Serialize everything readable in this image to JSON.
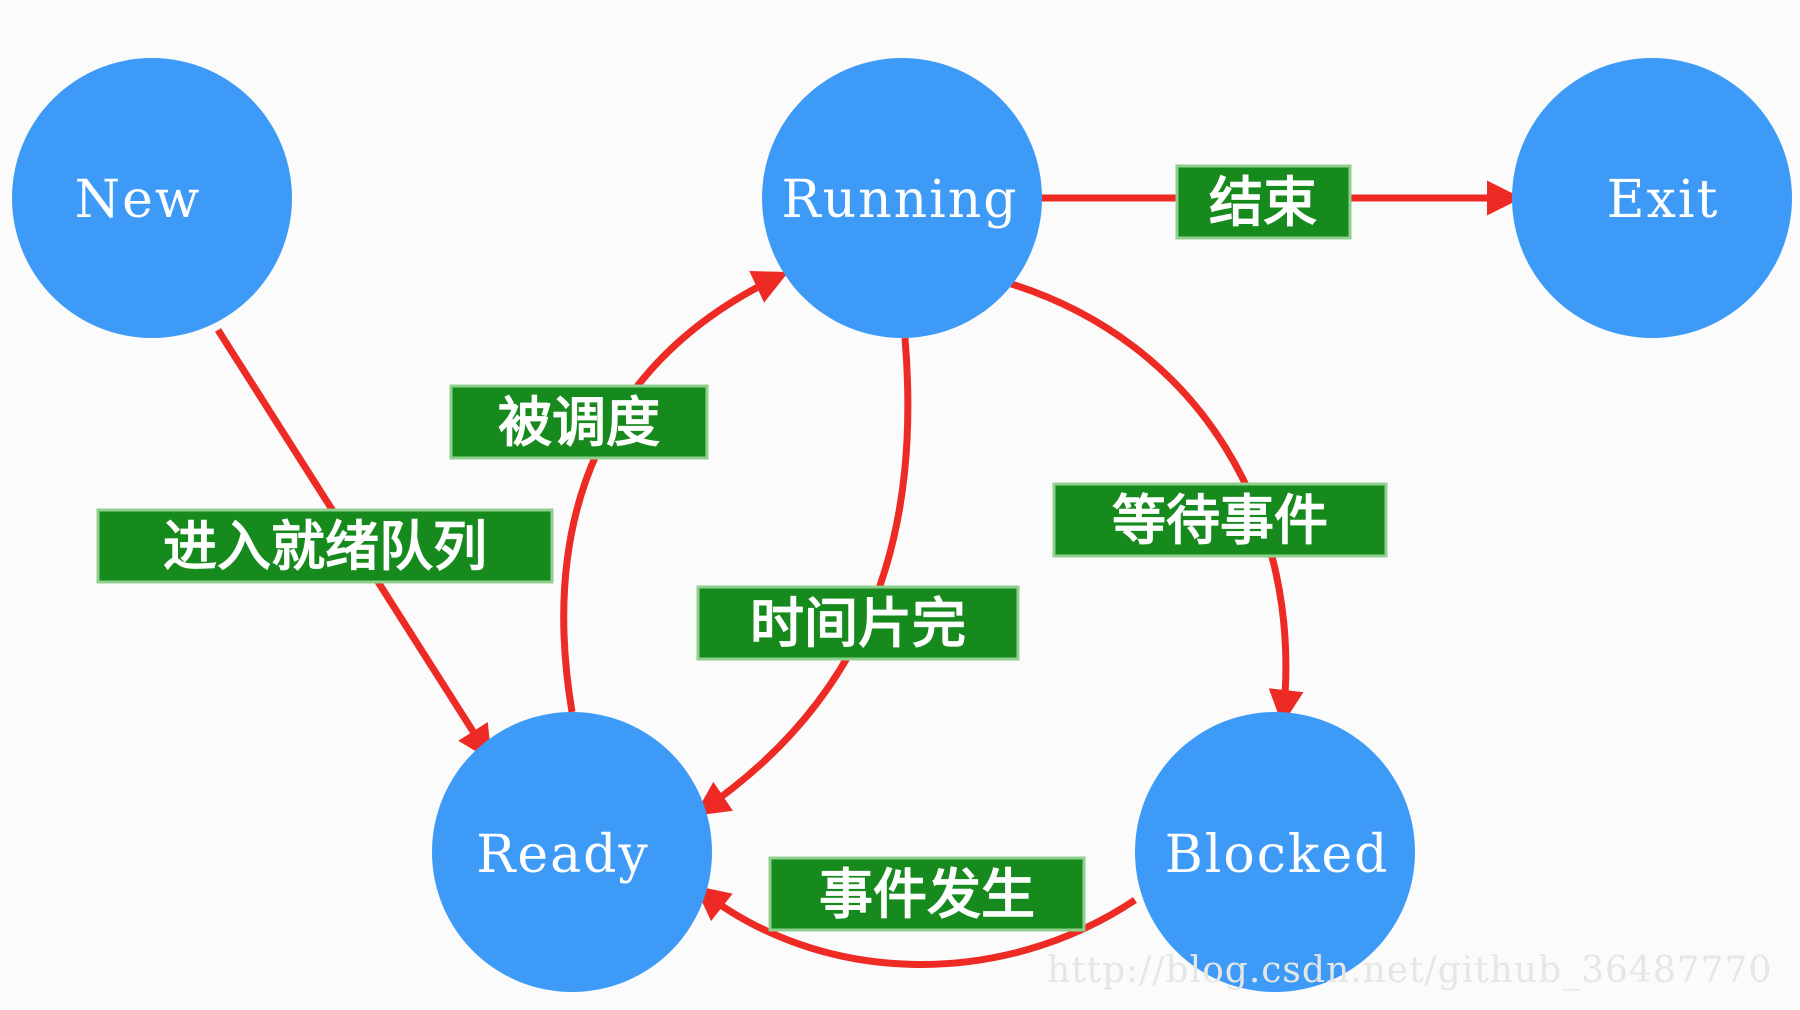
{
  "colors": {
    "state_fill": "#3d9bf7",
    "arrow": "#ee2a24",
    "label_fill": "#178a1e",
    "label_border": "#8fd08f"
  },
  "states": {
    "new": "New",
    "running": "Running",
    "exit": "Exit",
    "ready": "Ready",
    "blocked": "Blocked"
  },
  "edges": {
    "new_to_ready": "进入就绪队列",
    "ready_to_running": "被调度",
    "running_to_exit": "结束",
    "running_to_ready": "时间片完",
    "running_to_blocked": "等待事件",
    "blocked_to_ready": "事件发生"
  },
  "watermark": "http://blog.csdn.net/github_36487770"
}
